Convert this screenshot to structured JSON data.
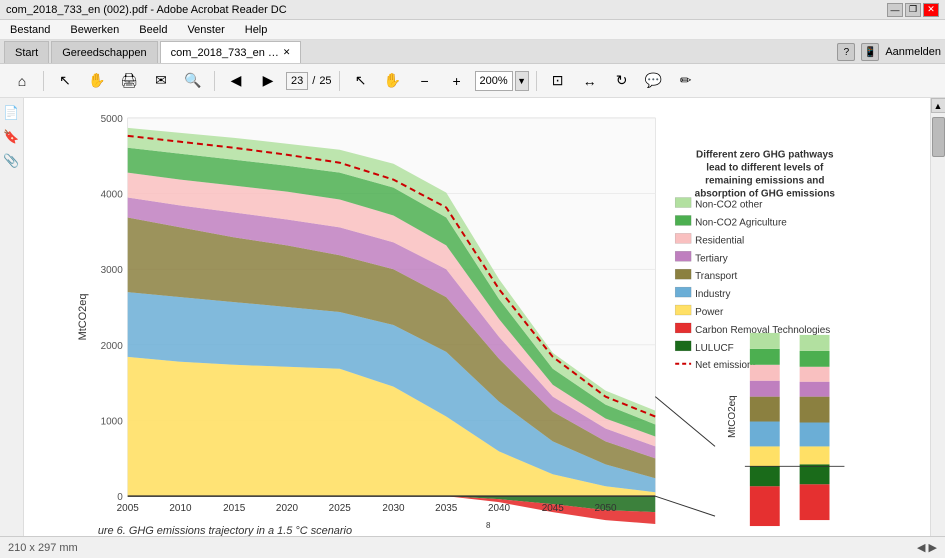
{
  "titleBar": {
    "title": "com_2018_733_en (002).pdf - Adobe Acrobat Reader DC",
    "winControls": [
      "—",
      "❐",
      "✕"
    ]
  },
  "menuBar": {
    "items": [
      "Bestand",
      "Bewerken",
      "Beeld",
      "Venster",
      "Help"
    ]
  },
  "tabs": [
    {
      "label": "Start",
      "active": false
    },
    {
      "label": "Gereedschappen",
      "active": false
    },
    {
      "label": "com_2018_733_en … ×",
      "active": true
    }
  ],
  "toolbar": {
    "zoomLevel": "200%",
    "pageNumber": "23",
    "totalPages": "25"
  },
  "legend": {
    "items": [
      {
        "label": "Non-CO2 other",
        "color": "#b2e0a0"
      },
      {
        "label": "Non-CO2 Agriculture",
        "color": "#4caf50"
      },
      {
        "label": "Residential",
        "color": "#f9c0c0"
      },
      {
        "label": "Tertiary",
        "color": "#bf7fbf"
      },
      {
        "label": "Transport",
        "color": "#8b8040"
      },
      {
        "label": "Industry",
        "color": "#6baed6"
      },
      {
        "label": "Power",
        "color": "#ffe066"
      },
      {
        "label": "Carbon Removal Technologies",
        "color": "#e53030"
      },
      {
        "label": "LULUCF",
        "color": "#1a6b1a"
      },
      {
        "label": "Net emissions",
        "color": "#cc0000",
        "dashed": true
      }
    ]
  },
  "chart": {
    "yAxisLabel": "MtCO2eq",
    "xAxisYears": [
      "2005",
      "2010",
      "2015",
      "2020",
      "2025",
      "2030",
      "2035",
      "2040",
      "2045",
      "2050"
    ],
    "yAxisValues": [
      "5000",
      "4000",
      "3000",
      "2000",
      "1000",
      "0"
    ],
    "title": "Different zero GHG pathways\nlead to different levels of\nremaining emissions and\nabsorption of GHG emissions"
  },
  "caption": "ure 6. GHG emissions trajectory in a 1.5 °C scenario",
  "captionSuperscript": "8",
  "statusBar": {
    "pageSize": "210 x 297 mm",
    "scrollPosition": ""
  }
}
